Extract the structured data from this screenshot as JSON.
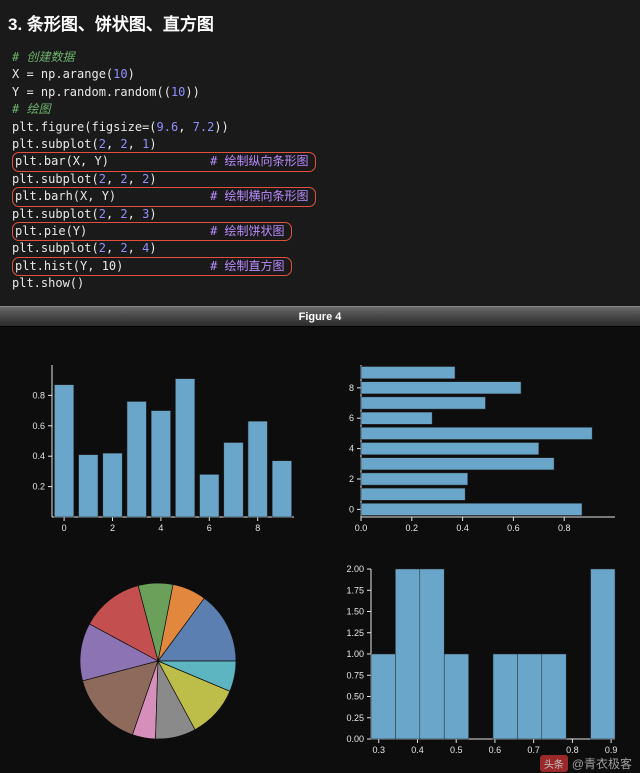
{
  "title": "3. 条形图、饼状图、直方图",
  "code": {
    "comment1": "# 创建数据",
    "l1a": "X = np.arange(",
    "l1n": "10",
    "l1b": ")",
    "l2a": "Y = np.random.random((",
    "l2n": "10",
    "l2b": "))",
    "comment2": "# 绘图",
    "l3a": "plt.figure(figsize=(",
    "l3n1": "9.6",
    "l3c": ", ",
    "l3n2": "7.2",
    "l3b": "))",
    "l4a": "plt.subplot(",
    "l4n1": "2",
    "l4n2": "2",
    "l4n3": "1",
    "l4b": ")",
    "hl1": "plt.bar(X, Y)",
    "cmt1": "# 绘制纵向条形图",
    "l5a": "plt.subplot(",
    "l5n1": "2",
    "l5n2": "2",
    "l5n3": "2",
    "l5b": ")",
    "hl2": "plt.barh(X, Y)",
    "cmt2": "# 绘制横向条形图",
    "l6a": "plt.subplot(",
    "l6n1": "2",
    "l6n2": "2",
    "l6n3": "3",
    "l6b": ")",
    "hl3": "plt.pie(Y)",
    "cmt3": "# 绘制饼状图",
    "l7a": "plt.subplot(",
    "l7n1": "2",
    "l7n2": "2",
    "l7n3": "4",
    "l7b": ")",
    "hl4": "plt.hist(Y, 10)",
    "cmt4": "# 绘制直方图",
    "l8": "plt.show()"
  },
  "figure_title": "Figure 4",
  "watermark": {
    "prefix": "头条",
    "author": "@青衣极客"
  },
  "chart_data": [
    {
      "type": "bar",
      "categories": [
        0,
        1,
        2,
        3,
        4,
        5,
        6,
        7,
        8,
        9
      ],
      "values": [
        0.87,
        0.41,
        0.42,
        0.76,
        0.7,
        0.91,
        0.28,
        0.49,
        0.63,
        0.37
      ],
      "xlim": [
        -0.5,
        9.5
      ],
      "ylim": [
        0.0,
        1.0
      ],
      "xticks": [
        0,
        2,
        4,
        6,
        8
      ],
      "yticks": [
        0.2,
        0.4,
        0.6,
        0.8
      ]
    },
    {
      "type": "barh",
      "categories": [
        0,
        1,
        2,
        3,
        4,
        5,
        6,
        7,
        8,
        9
      ],
      "values": [
        0.87,
        0.41,
        0.42,
        0.76,
        0.7,
        0.91,
        0.28,
        0.49,
        0.63,
        0.37
      ],
      "xlim": [
        0.0,
        1.0
      ],
      "ylim": [
        -0.5,
        9.5
      ],
      "xticks": [
        0.0,
        0.2,
        0.4,
        0.6,
        0.8
      ],
      "yticks": [
        0,
        2,
        4,
        6,
        8
      ]
    },
    {
      "type": "pie",
      "values": [
        0.87,
        0.41,
        0.42,
        0.76,
        0.7,
        0.91,
        0.28,
        0.49,
        0.63,
        0.37
      ],
      "colors": [
        "#5a7fb0",
        "#e1873e",
        "#6aa05a",
        "#c34f4f",
        "#8c74b4",
        "#8d6a5c",
        "#d68fba",
        "#8a8a8a",
        "#bdbd4a",
        "#5cb5c0"
      ]
    },
    {
      "type": "hist",
      "bin_edges": [
        0.28,
        0.343,
        0.406,
        0.469,
        0.532,
        0.595,
        0.658,
        0.721,
        0.784,
        0.847,
        0.91
      ],
      "counts": [
        1,
        2,
        2,
        1,
        0,
        1,
        1,
        1,
        0,
        2
      ],
      "xticks": [
        0.3,
        0.4,
        0.5,
        0.6,
        0.7,
        0.8,
        0.9
      ],
      "yticks": [
        0.0,
        0.25,
        0.5,
        0.75,
        1.0,
        1.25,
        1.5,
        1.75,
        2.0
      ],
      "xlim": [
        0.28,
        0.91
      ],
      "ylim": [
        0,
        2.0
      ]
    }
  ]
}
